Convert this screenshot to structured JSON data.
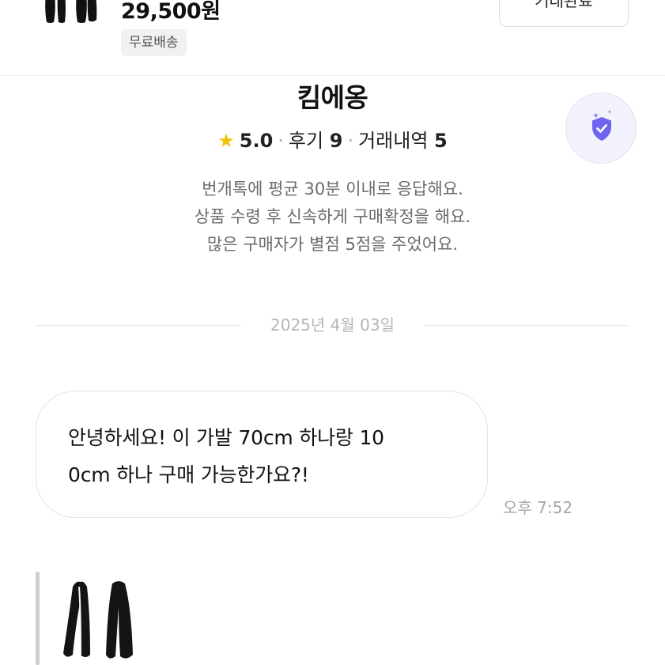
{
  "product": {
    "price": "29,500원",
    "shipping_badge": "무료배송",
    "action_button": "거래완료"
  },
  "seller": {
    "name": "킴에옹",
    "rating": "5.0",
    "review_label": "후기",
    "review_count": "9",
    "trade_label": "거래내역",
    "trade_count": "5",
    "star_color": "#f4c20d",
    "badge_icon": "shield-check-icon",
    "badge_color": "#6f64f0",
    "descriptions": [
      "번개톡에 평균 30분 이내로 응답해요.",
      "상품 수령 후 신속하게 구매확정을 해요.",
      "많은 구매자가 별점 5점을 주었어요."
    ]
  },
  "chat": {
    "date": "2025년 4월 03일",
    "messages": [
      {
        "lines": [
          "안녕하세요! 이 가발 70cm 하나랑 10",
          "0cm 하나 구매 가능한가요?!"
        ],
        "time": "오후 7:52"
      }
    ]
  }
}
